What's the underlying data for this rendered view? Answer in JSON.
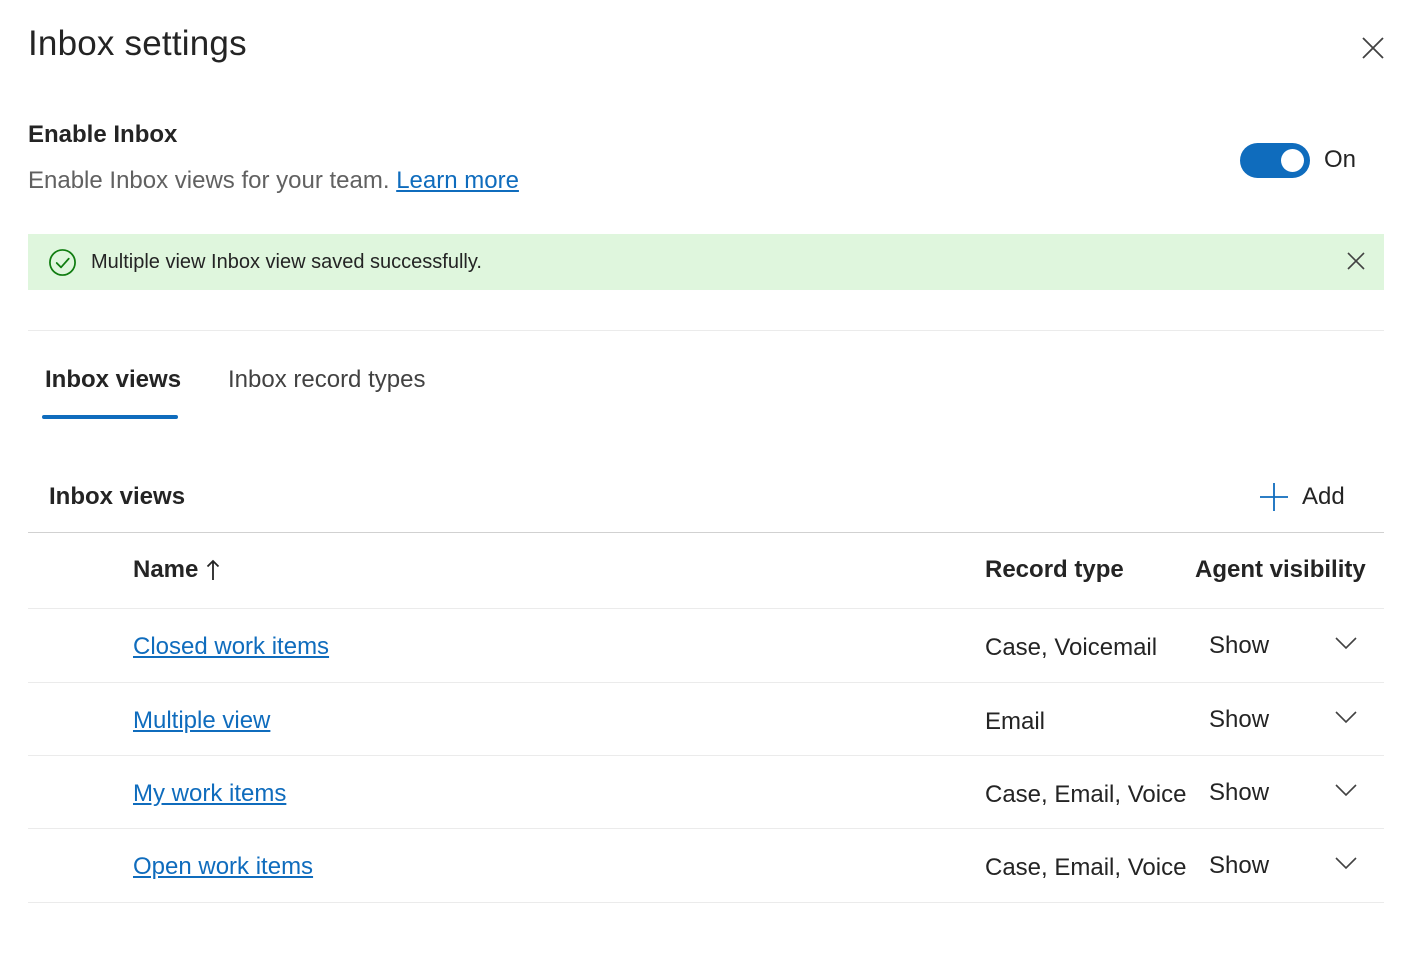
{
  "panel": {
    "title": "Inbox settings",
    "close_icon": "close-icon"
  },
  "enable": {
    "title": "Enable Inbox",
    "description": "Enable Inbox views for your team.",
    "learn_more": "Learn more",
    "toggle_state": "On",
    "toggle_on": true
  },
  "banner": {
    "message": "Multiple view Inbox view saved successfully.",
    "icon": "success-check-icon",
    "dismiss_icon": "close-icon"
  },
  "tabs": [
    {
      "label": "Inbox views",
      "active": true
    },
    {
      "label": "Inbox record types",
      "active": false
    }
  ],
  "section": {
    "title": "Inbox views",
    "add_label": "Add"
  },
  "table": {
    "columns": {
      "name": "Name",
      "record_type": "Record type",
      "agent_visibility": "Agent visibility"
    },
    "sort_icon": "sort-ascending-arrow-icon",
    "rows": [
      {
        "name": "Closed work items",
        "record_type": "Case, Voicemail",
        "visibility": "Show"
      },
      {
        "name": "Multiple view",
        "record_type": "Email",
        "visibility": "Show"
      },
      {
        "name": "My work items",
        "record_type": "Case, Email, Voice",
        "visibility": "Show"
      },
      {
        "name": "Open work items",
        "record_type": "Case, Email, Voice",
        "visibility": "Show"
      }
    ]
  },
  "colors": {
    "accent": "#0f6cbd",
    "success_bg": "#dff6dd",
    "success_icon": "#107c10",
    "text": "#242424"
  }
}
